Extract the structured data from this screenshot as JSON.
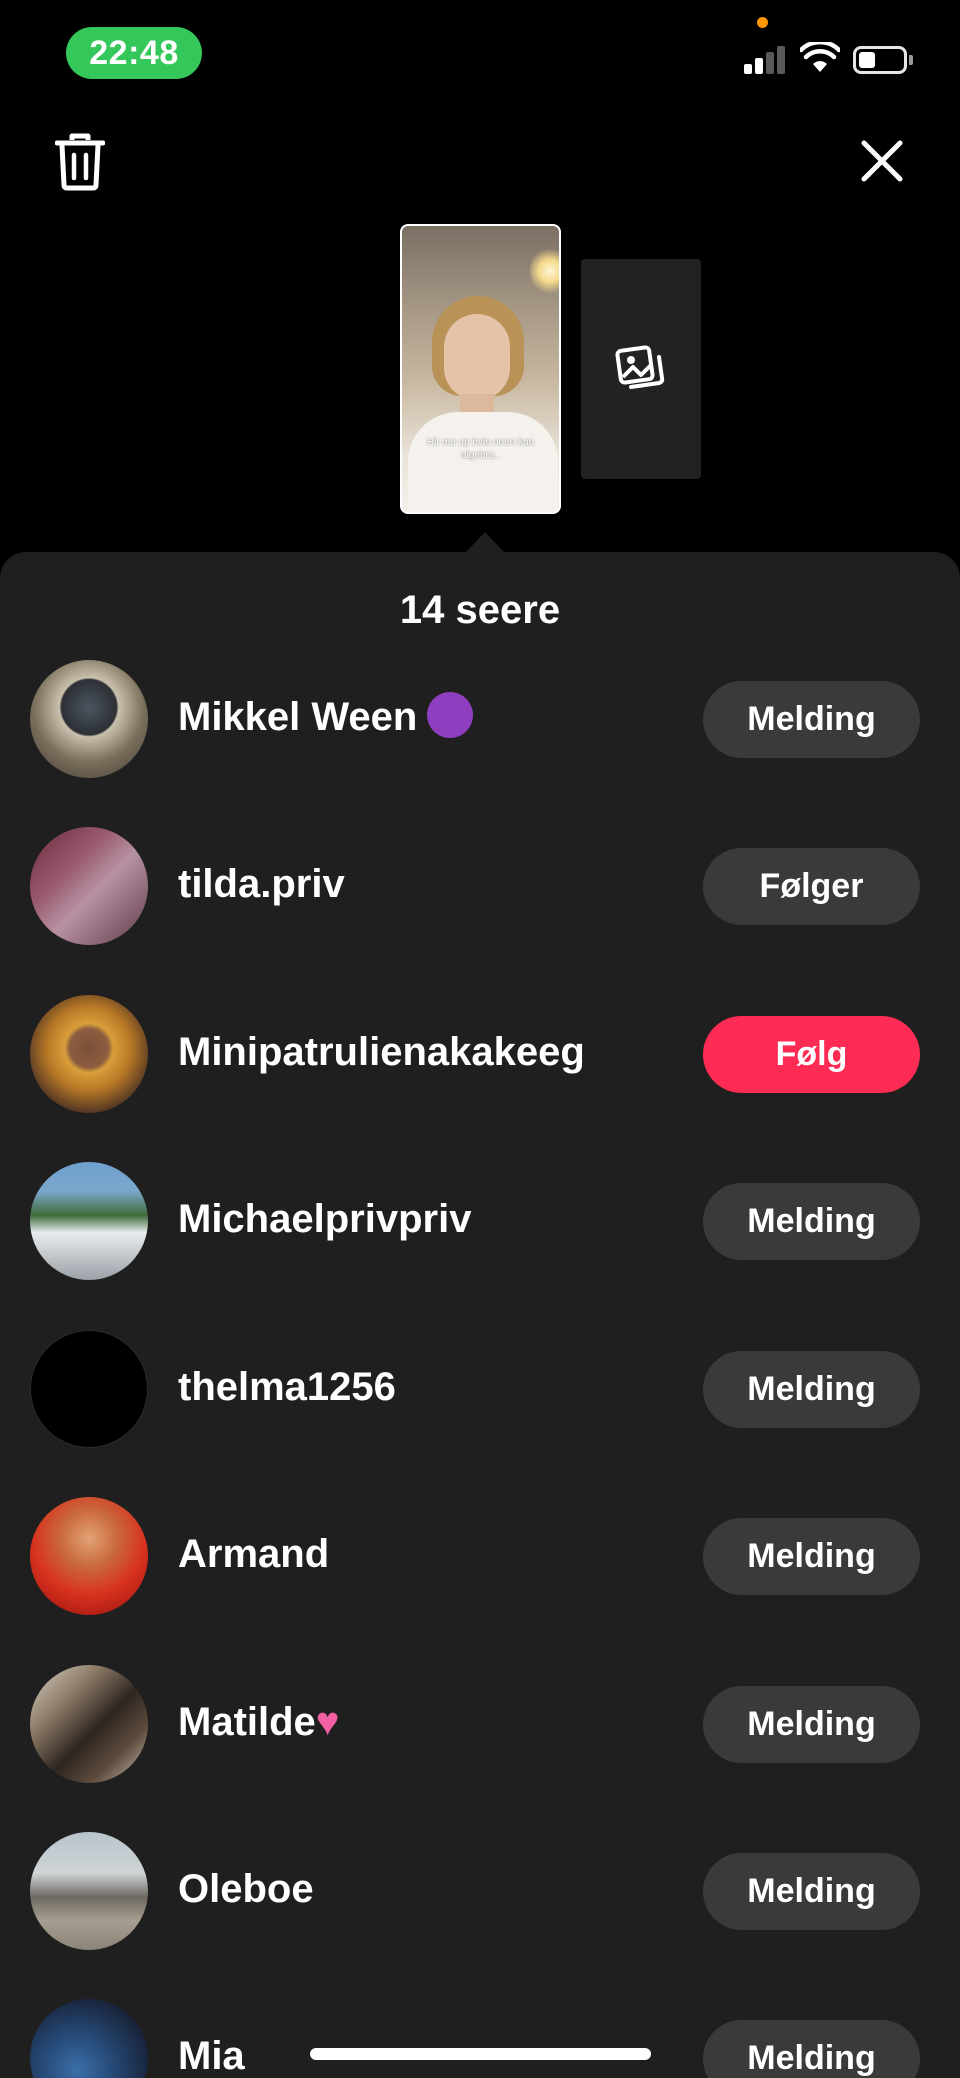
{
  "status_bar": {
    "time": "22:48",
    "time_pill_color": "#34c759",
    "icons": [
      "cellular-signal-icon",
      "wifi-icon",
      "battery-icon"
    ],
    "privacy_dot_color": "#ff9500"
  },
  "top_bar": {
    "left_icon": "trash-icon",
    "right_icon": "close-icon"
  },
  "story_preview": {
    "caption": "Hit me up hvis noen kan algebra..",
    "add_icon": "add-photo-icon"
  },
  "sheet": {
    "title": "14 seere",
    "background_color": "#1f1f1f"
  },
  "viewers": [
    {
      "name": "Mikkel Ween",
      "button": "Melding",
      "button_style": "secondary"
    },
    {
      "name": "tilda.priv",
      "button": "Følger",
      "button_style": "secondary"
    },
    {
      "name": "Minipatrulienakakeeg",
      "button": "Følg",
      "button_style": "primary"
    },
    {
      "name": "Michaelprivpriv",
      "button": "Melding",
      "button_style": "secondary"
    },
    {
      "name": "thelma1256",
      "button": "Melding",
      "button_style": "secondary"
    },
    {
      "name": "Armand",
      "button": "Melding",
      "button_style": "secondary"
    },
    {
      "name": "Matilde",
      "button": "Melding",
      "button_style": "secondary"
    },
    {
      "name": "Oleboe",
      "button": "Melding",
      "button_style": "secondary"
    },
    {
      "name": "Mia",
      "button": "Melding",
      "button_style": "secondary"
    }
  ],
  "colors": {
    "follow_button": "#fe2c55",
    "secondary_button": "#3a3a3a"
  }
}
